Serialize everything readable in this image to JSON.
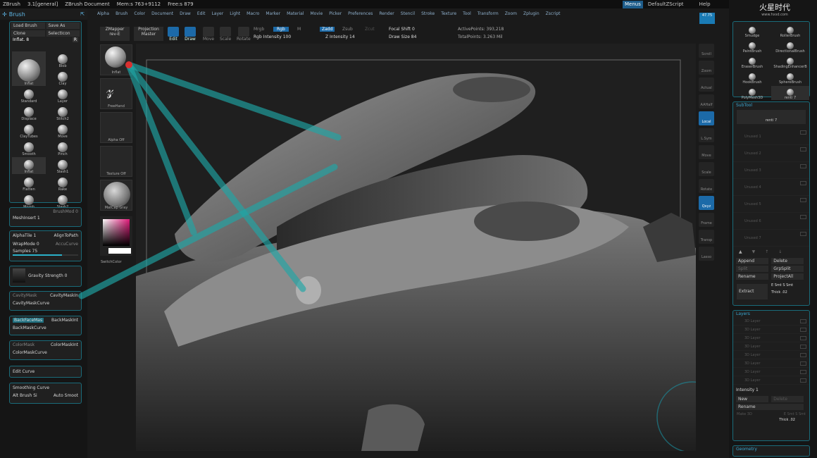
{
  "window": {
    "app": "ZBrush",
    "version": "3.1[general]",
    "document": "ZBrush Document",
    "mem": "Mem:s 763+9112",
    "free": "Free:s 879"
  },
  "menu": [
    "Alpha",
    "Brush",
    "Color",
    "Document",
    "Draw",
    "Edit",
    "Layer",
    "Light",
    "Macro",
    "Marker",
    "Material",
    "Movie",
    "Picker",
    "Preferences",
    "Render",
    "Stencil",
    "Stroke",
    "Texture",
    "Tool",
    "Transform",
    "Zoom",
    "Zplugin",
    "Zscript"
  ],
  "right_menu": {
    "menus": "Menus",
    "default_script": "DefaultZScript",
    "help": "Help"
  },
  "watermark": {
    "line1": "火星时代",
    "line2": "www.hxsd.com"
  },
  "brush_palette": {
    "title": "Brush",
    "load_brush": "Load Brush",
    "save_as": "Save As",
    "clone": "Clone",
    "select_icon": "SelectIcon",
    "current": "Inflat. 8",
    "r_label": "R",
    "brushes": [
      "Inflat",
      "Blob",
      "Clay",
      "Standard",
      "Layer",
      "Displace",
      "Stitch2",
      "ClayTubes",
      "Move",
      "Smooth",
      "Pinch",
      "Inflat",
      "Slash1",
      "Flatten",
      "Rake",
      "Morph",
      "Slash2"
    ]
  },
  "brush_settings": {
    "brush_mod": "BrushMod 0",
    "mesh_insert": "MeshInsert 1",
    "alpha_tile": "AlphaTile 1",
    "align_to_path": "AlignToPath",
    "wrap_mode": "WrapMode 0",
    "accu_curve": "AccuCurve",
    "samples": "Samples 75",
    "gravity": "Gravity Strength 0",
    "cavity_mask": "CavityMask",
    "cavity_mask_int": "CavityMaskIn",
    "cavity_mask_curve": "CavityMaskCurve",
    "backface_mask": "BackFaceMas",
    "backmask_int": "BackMaskInt",
    "backmask_curve": "BackMaskCurve",
    "color_mask": "ColorMask",
    "color_mask_int": "ColorMaskInt",
    "color_mask_curve": "ColorMaskCurve",
    "edit_curve": "Edit Curve",
    "smoothing_curve": "Smoothing Curve",
    "alt_brush": "Alt Brush Si",
    "auto_smooth": "Auto Smoot",
    "samples_fill": 0.75,
    "gravity_fill": 0.0
  },
  "toolbar": {
    "zmapper": "ZMapper",
    "zmapper_sub": "rev-E",
    "projection": "Projection",
    "projection_sub": "Master",
    "edit": "Edit",
    "draw": "Draw",
    "move": "Move",
    "scale": "Scale",
    "rotate": "Rotate",
    "mrgb": "Mrgb",
    "rgb": "Rgb",
    "m": "M",
    "zadd": "Zadd",
    "zsub": "Zsub",
    "zcut": "Zcut",
    "rgb_intensity": "Rgb Intensity 100",
    "z_intensity": "Z Intensity 14",
    "focal_shift": "Focal Shift 0",
    "draw_size": "Draw Size 84",
    "active_points": "ActivePoints: 393,218",
    "total_points": "TotalPoints: 3.263 Mil"
  },
  "shelf": {
    "inflat": "Inflat",
    "freehand": "FreeHand",
    "alpha_off": "Alpha Off",
    "texture_off": "Texture Off",
    "matcap": "MatCap Gray",
    "switch_color": "SwitchColor"
  },
  "right_shelf": {
    "counter": "47.75",
    "buttons": [
      "Scroll",
      "Zoom",
      "Actual",
      "AAHalf",
      "Local",
      "L.Sym",
      "Move",
      "Scale",
      "Rotate",
      "Qxyz",
      "Frame",
      "Transp",
      "Lasso"
    ]
  },
  "tool_palette": {
    "tools": [
      "Smudge",
      "RollerBrush",
      "PaintBrush",
      "DirectionalBrush",
      "EraserBrush",
      "ShadingEnhancerB",
      "HookBrush",
      "SphereBrush",
      "PolyMesh3D",
      "renti 7"
    ]
  },
  "subtool": {
    "title": "SubTool",
    "active": "renti 7",
    "unused": [
      "Unused 1",
      "Unused 2",
      "Unused 3",
      "Unused 4",
      "Unused 5",
      "Unused 6",
      "Unused 7"
    ],
    "append": "Append",
    "delete": "Delete",
    "split": "Split",
    "grpsplit": "GrpSplit",
    "rename": "Rename",
    "project_all": "ProjectAll",
    "extract": "Extract",
    "e_smt": "E Smt",
    "s_smt": "S Smt",
    "thick": "Thick .02"
  },
  "layers": {
    "title": "Layers",
    "items": [
      "3D Layer",
      "3D Layer",
      "3D Layer",
      "3D Layer",
      "3D Layer",
      "3D Layer",
      "3D Layer",
      "3D Layer"
    ],
    "intensity": "Intensity 1",
    "new": "New",
    "delete": "Delete",
    "rename": "Rename",
    "make_3d": "Make 3D",
    "e_smt": "E Smt",
    "s_smt": "S Smt",
    "thick": "Thick .02"
  },
  "geometry": {
    "title": "Geometry"
  }
}
